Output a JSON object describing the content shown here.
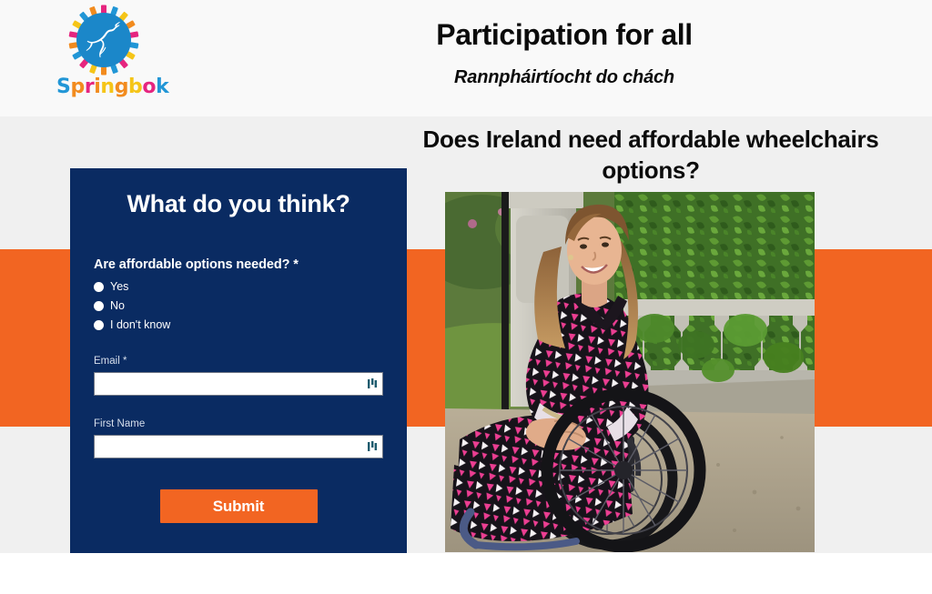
{
  "brand": {
    "name": "Springbok",
    "letters": [
      {
        "char": "S",
        "color": "#2196d6"
      },
      {
        "char": "p",
        "color": "#f28b1e"
      },
      {
        "char": "r",
        "color": "#e6257f"
      },
      {
        "char": "i",
        "color": "#f28b1e"
      },
      {
        "char": "n",
        "color": "#f5c518"
      },
      {
        "char": "g",
        "color": "#f28b1e"
      },
      {
        "char": "b",
        "color": "#f5c518"
      },
      {
        "char": "o",
        "color": "#e6257f"
      },
      {
        "char": "k",
        "color": "#2196d6"
      }
    ],
    "logo_icon": "springbok-antelope-logo"
  },
  "header": {
    "title": "Participation for all",
    "subtitle": "Rannpháirtíocht do chách"
  },
  "main": {
    "question_heading": "Does Ireland need affordable wheelchairs options?",
    "photo_alt": "Smiling woman in a pink and black patterned dress seated in a wheelchair on a gravel garden path beside an ivy-covered stone balustrade"
  },
  "form": {
    "title": "What do you think?",
    "question_label": "Are affordable options needed? *",
    "options": [
      {
        "label": "Yes",
        "selected": false
      },
      {
        "label": "No",
        "selected": false
      },
      {
        "label": "I don't know",
        "selected": false
      }
    ],
    "fields": [
      {
        "label": "Email *",
        "value": "",
        "placeholder": "",
        "icon": "autofill-icon"
      },
      {
        "label": "First Name",
        "value": "",
        "placeholder": "",
        "icon": "autofill-icon"
      }
    ],
    "submit_label": "Submit"
  },
  "colors": {
    "navy": "#0a2b62",
    "orange": "#f26522",
    "header_bg": "#f9f9f9",
    "body_bg": "#f0f0f0",
    "logo_blue": "#1b87c9"
  }
}
